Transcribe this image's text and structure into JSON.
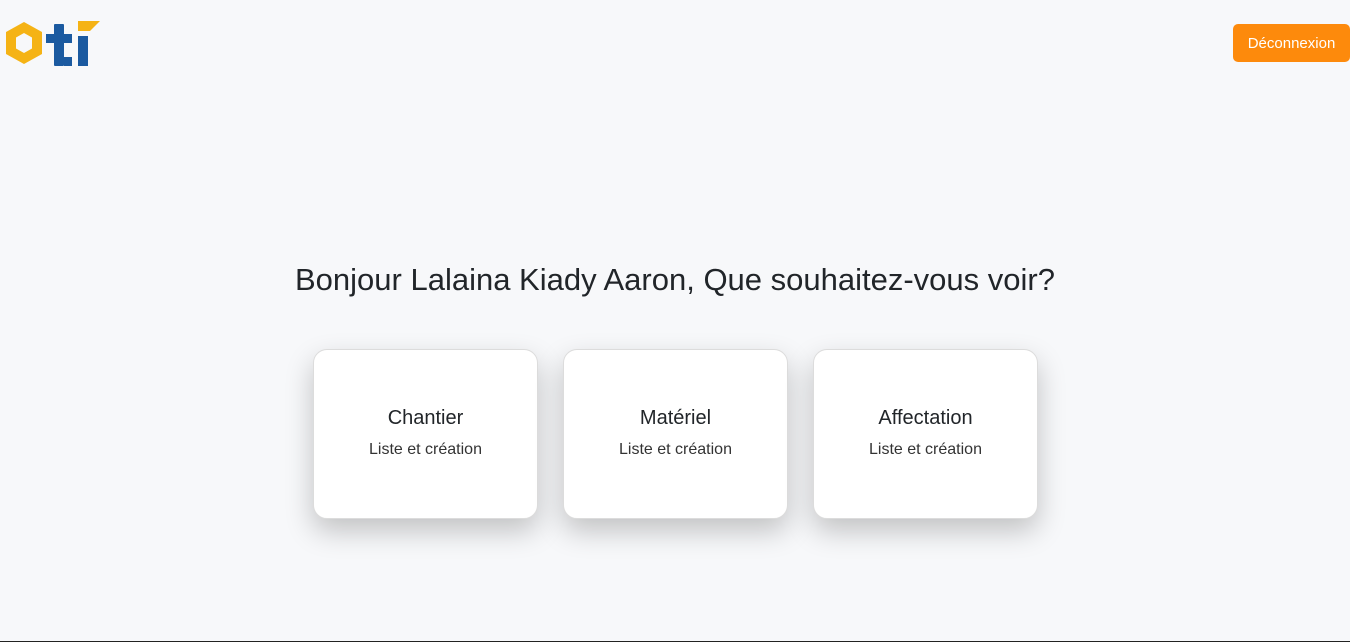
{
  "header": {
    "logo_text": "oti",
    "logout_label": "Déconnexion"
  },
  "main": {
    "greeting": "Bonjour Lalaina Kiady Aaron, Que souhaitez-vous voir?",
    "cards": [
      {
        "title": "Chantier",
        "subtitle": "Liste et création"
      },
      {
        "title": "Matériel",
        "subtitle": "Liste et création"
      },
      {
        "title": "Affectation",
        "subtitle": "Liste et création"
      }
    ]
  },
  "colors": {
    "background": "#f7f8fa",
    "accent": "#fd8a0c",
    "logo_yellow": "#f5b315",
    "logo_blue": "#1b5aa0"
  }
}
